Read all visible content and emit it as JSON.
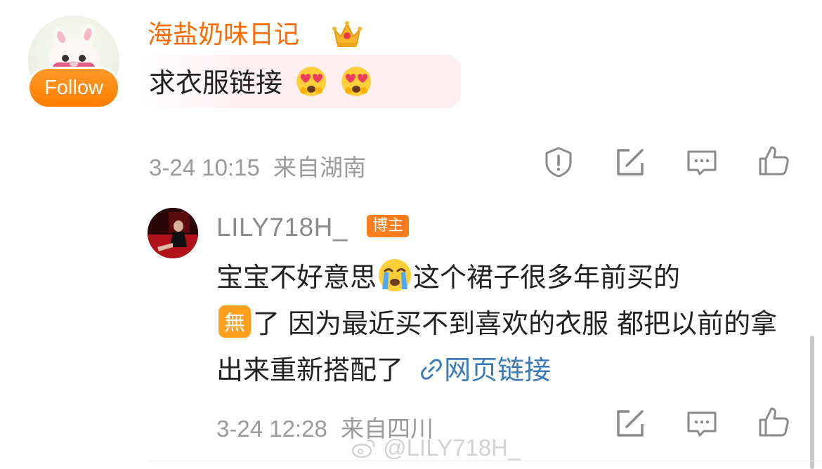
{
  "comment": {
    "username": "海盐奶味日记",
    "follow_label": "Follow",
    "text": "求衣服链接",
    "time": "3-24 10:15",
    "location": "来自湖南"
  },
  "reply": {
    "username": "LILY718H_",
    "badge": "博主",
    "text_part1": "宝宝不好意思",
    "text_part2": "这个裙子很多年前买的",
    "text_part3": "了 因为最近买不到喜欢的衣服 都把以前的拿出来重新搭配了",
    "link_label": "网页链接",
    "time": "3-24 12:28",
    "location": "来自四川"
  },
  "watermark": "@LILY718H_",
  "icons": {
    "report": "report-icon",
    "share": "share-icon",
    "comment": "comment-icon",
    "like": "like-icon",
    "crown": "crown-icon",
    "heart_eyes": "heart-eyes-emoji",
    "crying": "crying-emoji",
    "wu": "wu-emoji",
    "link": "link-icon"
  },
  "colors": {
    "username_orange": "#ff6a00",
    "follow_orange": "#ff8a10",
    "link_blue": "#3b7ab8",
    "meta_gray": "#9a9a9a"
  }
}
